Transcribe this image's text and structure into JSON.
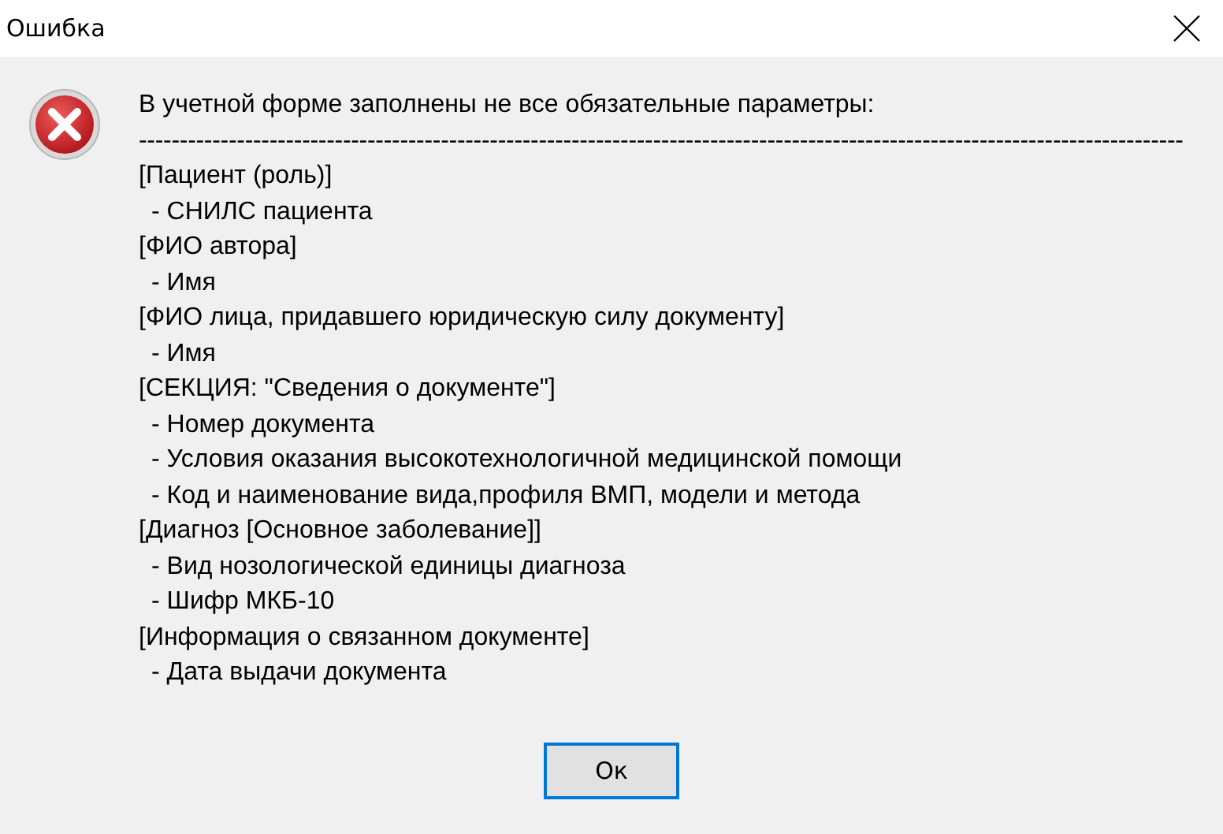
{
  "window": {
    "title": "Ошибка"
  },
  "message": {
    "heading": "В учетной форме заполнены не все обязательные параметры:",
    "separator": "--------------------------------------------------------------------------------------------------------------------------------",
    "sections": [
      {
        "title": "[Пациент (роль)]",
        "items": [
          "- СНИЛС пациента"
        ]
      },
      {
        "title": "[ФИО автора]",
        "items": [
          "- Имя"
        ]
      },
      {
        "title": "[ФИО лица, придавшего юридическую силу документу]",
        "items": [
          "- Имя"
        ]
      },
      {
        "title": "[СЕКЦИЯ: \"Сведения о документе\"]",
        "items": [
          "- Номер документа",
          "- Условия оказания высокотехнологичной медицинской помощи",
          "- Код и наименование вида,профиля ВМП, модели и метода"
        ]
      },
      {
        "title": "[Диагноз [Основное заболевание]]",
        "items": [
          "- Вид нозологической единицы диагноза",
          "- Шифр МКБ-10"
        ]
      },
      {
        "title": "[Информация о связанном документе]",
        "items": [
          "- Дата выдачи документа"
        ]
      }
    ]
  },
  "buttons": [
    {
      "label": "Ок",
      "selected": true
    }
  ]
}
